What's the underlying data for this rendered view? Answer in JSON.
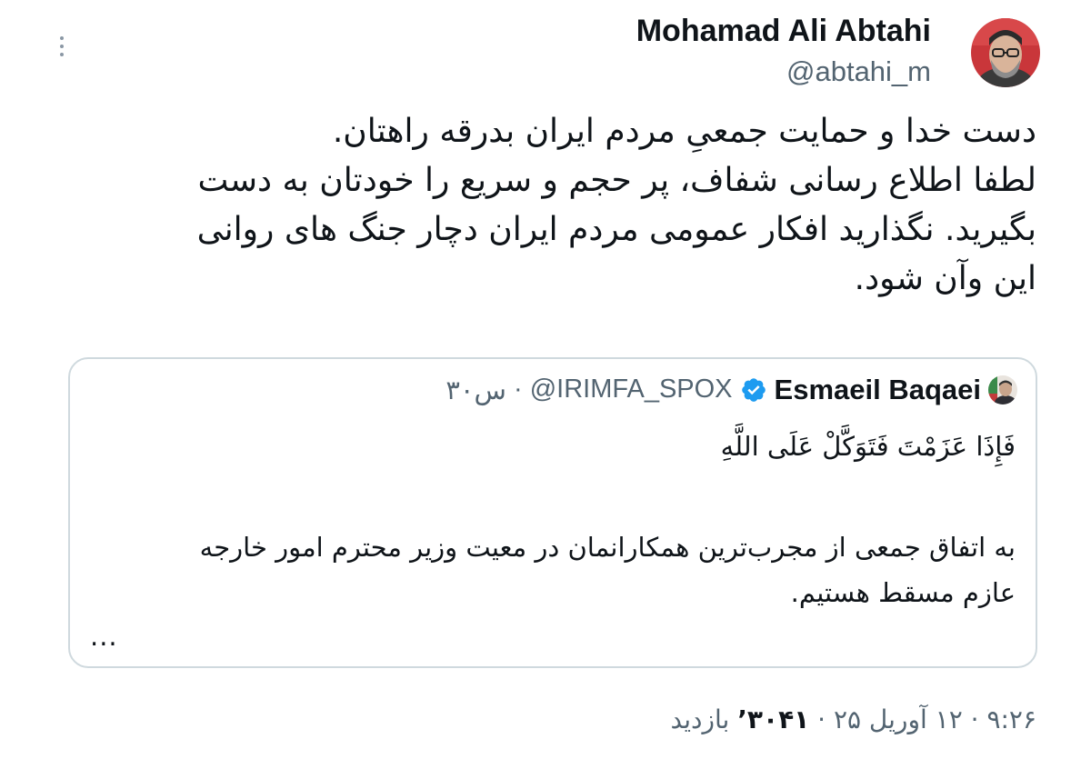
{
  "author": {
    "name": "Mohamad Ali Abtahi",
    "handle": "@abtahi_m",
    "more_icon": "more-vertical-icon"
  },
  "tweet": {
    "lines": [
      "دست خدا و حمایت جمعیِ مردم ایران بدرقه راهتان.",
      "لطفا اطلاع رسانی شفاف، پر حجم و سریع را خودتان به دست",
      "بگیرید. نگذارید افکار عمومی مردم ایران دچار جنگ های روانی",
      "این وآن شود."
    ]
  },
  "quote": {
    "name": "Esmaeil Baqaei",
    "verified_icon": "verified-badge-icon",
    "verified_color": "#1d9bf0",
    "handle": "@IRIMFA_SPOX",
    "separator": " · ",
    "time": "۳۰س",
    "verse": "فَإِذَا عَزَمْتَ فَتَوَكَّلْ عَلَى اللَّهِ",
    "body_lines": [
      "به اتفاق جمعی از مجرب‌ترین همکارانمان در معیت وزیر محترم امور خارجه",
      "عازم مسقط هستیم."
    ],
    "ellipsis": "..."
  },
  "footer": {
    "time": "۹:۲۶",
    "sep1": " · ",
    "date": "۱۲ آوریل ۲۵",
    "sep2": " · ",
    "views_count": "۳۰۴۱’",
    "views_label": " بازدید"
  },
  "colors": {
    "text": "#0f1419",
    "secondary": "#536471",
    "border": "#cfd9de",
    "accent": "#1d9bf0"
  }
}
